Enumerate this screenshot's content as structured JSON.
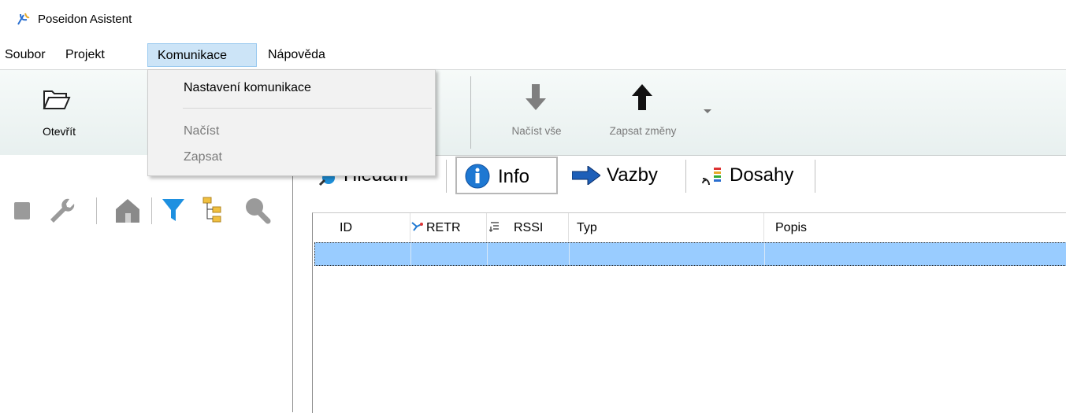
{
  "window": {
    "title": "Poseidon Asistent",
    "icon": "trident-icon"
  },
  "menubar": {
    "items": [
      {
        "label": "Soubor"
      },
      {
        "label": "Projekt"
      },
      {
        "label": "Komunikace",
        "active": true
      },
      {
        "label": "Nápověda"
      }
    ]
  },
  "dropdown": {
    "items": [
      {
        "label": "Nastavení komunikace",
        "enabled": true
      },
      {
        "label": "Načíst",
        "enabled": false
      },
      {
        "label": "Zapsat",
        "enabled": false
      }
    ]
  },
  "toolbar": {
    "open_label": "Otevřít",
    "read_all_label": "Načíst vše",
    "write_changes_label": "Zapsat změny"
  },
  "left_tools": [
    "stop-icon",
    "wrench-icon",
    "home-icon",
    "filter-icon",
    "tree-icon",
    "search-icon"
  ],
  "tabs": [
    {
      "label": "Hledání",
      "icon": "search-plus-icon"
    },
    {
      "label": "Info",
      "icon": "info-icon",
      "selected": true
    },
    {
      "label": "Vazby",
      "icon": "arrow-right-icon"
    },
    {
      "label": "Dosahy",
      "icon": "signal-icon"
    }
  ],
  "table": {
    "columns": [
      {
        "label": "ID"
      },
      {
        "label": "RETR",
        "icon": "retry-icon"
      },
      {
        "label": "RSSI",
        "icon": "sort-icon"
      },
      {
        "label": "Typ"
      },
      {
        "label": "Popis"
      }
    ],
    "selected_row": [
      "",
      "",
      "",
      "",
      ""
    ]
  },
  "colors": {
    "selection": "#99ccff",
    "menu_active": "#cce4f7",
    "info_blue": "#1e78d2",
    "filter_blue": "#1e90e0"
  }
}
